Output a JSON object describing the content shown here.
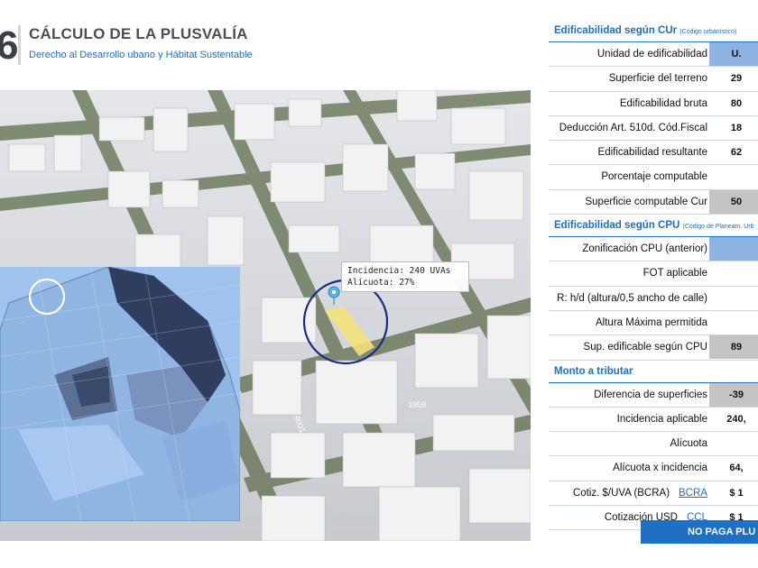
{
  "header": {
    "slide_number": "6",
    "title": "CÁLCULO DE LA PLUSVALÍA",
    "subtitle": "Derecho al Desarrollo ubano y Hábitat Sustentable"
  },
  "map": {
    "tooltip_line1": "Incidencia: 240 UVAs",
    "tooltip_line2": "Alícuota: 27%",
    "street_labels": [
      "4001",
      "3959"
    ]
  },
  "panel": {
    "section_cur": {
      "title": "Edificabilidad según CUr",
      "note": "(Código urbanístico)"
    },
    "section_cpu": {
      "title": "Edificabilidad según CPU",
      "note": "(Código de Planeam. Urb"
    },
    "section_monto": {
      "title": "Monto a tributar"
    },
    "rows_cur": [
      {
        "label": "Unidad de edificabilidad",
        "value": "U.",
        "style": "blue"
      },
      {
        "label": "Superficie del terreno",
        "value": "29",
        "style": ""
      },
      {
        "label": "Edificabilidad bruta",
        "value": "80",
        "style": ""
      },
      {
        "label": "Deducción Art. 510d. Cód.Fiscal",
        "value": "18",
        "style": ""
      },
      {
        "label": "Edificabilidad resultante",
        "value": "62",
        "style": ""
      },
      {
        "label": "Porcentaje computable",
        "value": "",
        "style": ""
      },
      {
        "label": "Superficie computable Cur",
        "value": "50",
        "style": "grey"
      }
    ],
    "rows_cpu": [
      {
        "label": "Zonificación CPU (anterior)",
        "value": "",
        "style": "blue"
      },
      {
        "label": "FOT aplicable",
        "value": "",
        "style": ""
      },
      {
        "label": "R: h/d (altura/0,5 ancho de calle)",
        "value": "",
        "style": ""
      },
      {
        "label": "Altura Máxima permitida",
        "value": "",
        "style": ""
      },
      {
        "label": "Sup. edificable según CPU",
        "value": "89",
        "style": "grey"
      }
    ],
    "rows_monto": [
      {
        "label": "Diferencia de superficies",
        "value": "-39",
        "style": "grey"
      },
      {
        "label": "Incidencia aplicable",
        "value": "240,",
        "style": ""
      },
      {
        "label": "Alícuota",
        "value": "",
        "style": ""
      },
      {
        "label": "Alícuota x incidencia",
        "value": "64,",
        "style": ""
      },
      {
        "label": "Cotiz. $/UVA (BCRA)",
        "link": "BCRA",
        "value": "$ 1",
        "style": ""
      },
      {
        "label": "Cotización USD",
        "link": "CCL",
        "value": "$ 1",
        "style": ""
      }
    ],
    "status": "NO PAGA PLU"
  },
  "colors": {
    "accent": "#1f6fc2",
    "blue_cell": "#8db3e2",
    "grey_cell": "#c4c4c4"
  }
}
